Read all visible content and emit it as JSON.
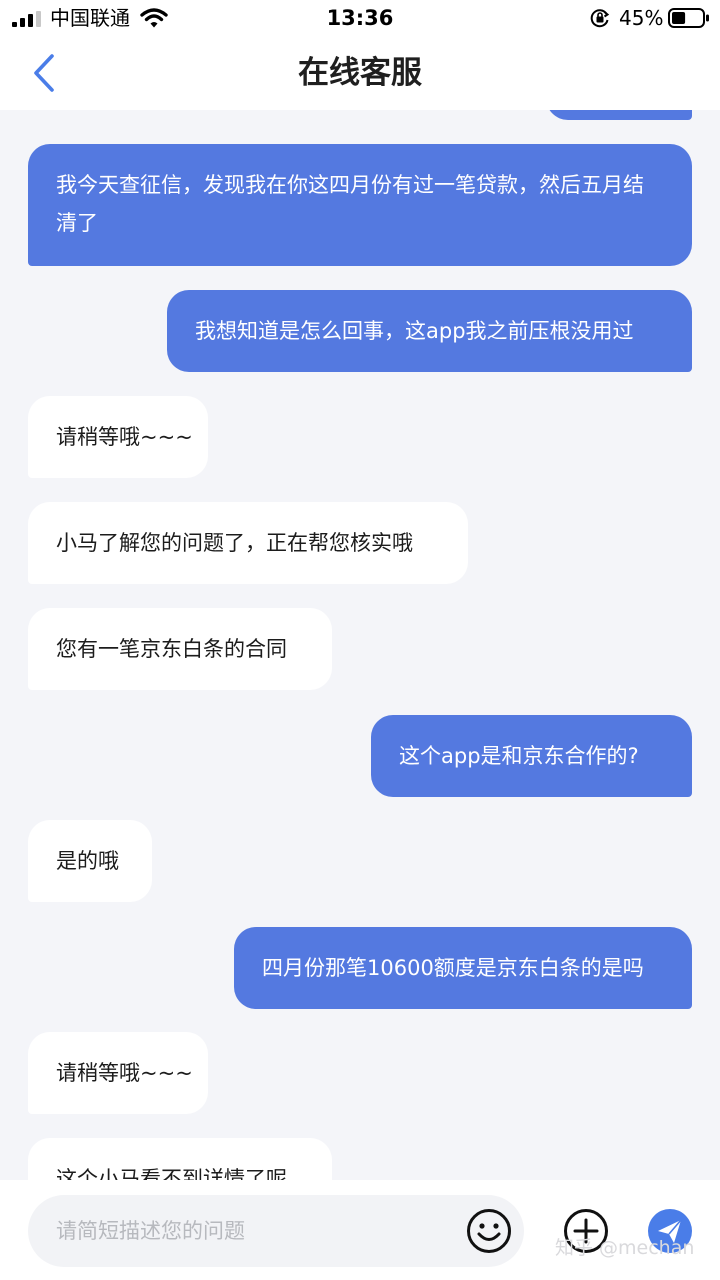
{
  "status_bar": {
    "carrier": "中国联通",
    "time": "13:36",
    "battery_percent": "45%",
    "battery_level": 0.45
  },
  "header": {
    "title": "在线客服"
  },
  "messages": [
    {
      "from": "user",
      "text": "我今天查征信，发现我在你这四月份有过一笔贷款，然后五月结清了"
    },
    {
      "from": "user",
      "text": "我想知道是怎么回事，这app我之前压根没用过"
    },
    {
      "from": "agent",
      "text": "请稍等哦~~~"
    },
    {
      "from": "agent",
      "text": "小马了解您的问题了，正在帮您核实哦"
    },
    {
      "from": "agent",
      "text": "您有一笔京东白条的合同"
    },
    {
      "from": "user",
      "text": "这个app是和京东合作的?"
    },
    {
      "from": "agent",
      "text": "是的哦"
    },
    {
      "from": "user",
      "text": "四月份那笔10600额度是京东白条的是吗"
    },
    {
      "from": "agent",
      "text": "请稍等哦~~~"
    },
    {
      "from": "agent",
      "text": "这个小马看不到详情了呢"
    }
  ],
  "input": {
    "placeholder": "请简短描述您的问题"
  },
  "watermark": "知乎 @mechan",
  "colors": {
    "accent": "#5479e0",
    "background": "#f4f5f9",
    "incoming_bubble": "#ffffff"
  },
  "icons": [
    "signal-icon",
    "wifi-icon",
    "rotation-lock-icon",
    "battery-icon",
    "back-arrow-icon",
    "emoji-icon",
    "add-icon",
    "send-icon"
  ]
}
